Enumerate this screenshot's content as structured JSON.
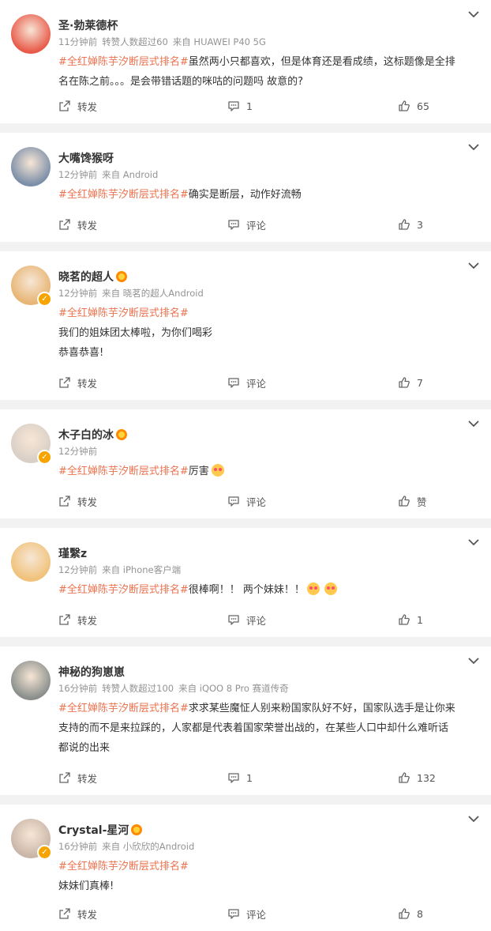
{
  "posts": [
    {
      "username": "圣·勃莱德杯",
      "has_badge": false,
      "verified": false,
      "meta": [
        "11分钟前",
        "转赞人数超过60",
        "来自 HUAWEI P40 5G"
      ],
      "lines": [
        [
          "#全红婵陈芋汐断层式排名#",
          "虽然两小只都喜欢，但是体育还是看成绩，这标题像是全排"
        ],
        [
          "",
          "名在陈之前。。。是会带错话题的咪咕的问题吗 故意的?"
        ]
      ],
      "forward_label": "转发",
      "comment_label": "1",
      "like_label": "65",
      "height": 156,
      "avatar_color": "#e85b4a"
    },
    {
      "username": "大嘴馋猴呀",
      "has_badge": false,
      "verified": false,
      "meta": [
        "12分钟前",
        "来自 Android"
      ],
      "lines": [
        [
          "#全红婵陈芋汐断层式排名#",
          "确实是断层，动作好流畅"
        ]
      ],
      "forward_label": "转发",
      "comment_label": "评论",
      "like_label": "3",
      "height": 138,
      "avatar_color": "#7c8fa8"
    },
    {
      "username": "晓茗的超人",
      "has_badge": true,
      "verified": true,
      "meta": [
        "12分钟前",
        "来自 晓茗的超人Android"
      ],
      "lines": [
        [
          "#全红婵陈芋汐断层式排名#",
          ""
        ],
        [
          "",
          "我们的姐妹团太棒啦，为你们喝彩"
        ],
        [
          "",
          "恭喜恭喜!"
        ]
      ],
      "forward_label": "转发",
      "comment_label": "评论",
      "like_label": "7",
      "height": 188,
      "avatar_color": "#e7b574"
    },
    {
      "username": "木子白的冰",
      "has_badge": true,
      "verified": true,
      "meta": [
        "12分钟前"
      ],
      "lines": [
        [
          "#全红婵陈芋汐断层式排名#",
          "厉害",
          "emoji"
        ]
      ],
      "forward_label": "转发",
      "comment_label": "评论",
      "like_label": "赞",
      "height": 138,
      "avatar_color": "#d9cfc6"
    },
    {
      "username": "瑾繄z",
      "has_badge": false,
      "verified": false,
      "meta": [
        "12分钟前",
        "来自 iPhone客户端"
      ],
      "lines": [
        [
          "#全红婵陈芋汐断层式排名#",
          "很棒啊！！ 两个妹妹！！",
          "emoji2"
        ]
      ],
      "forward_label": "转发",
      "comment_label": "评论",
      "like_label": "1",
      "height": 138,
      "avatar_color": "#f0c27a"
    },
    {
      "username": "神秘的狗崽崽",
      "has_badge": false,
      "verified": false,
      "meta": [
        "16分钟前",
        "转赞人数超过100",
        "来自 iQOO 8 Pro 赛道传奇"
      ],
      "lines": [
        [
          "#全红婵陈芋汐断层式排名#",
          "求求某些魔怔人别来粉国家队好不好，国家队选手是让你来"
        ],
        [
          "",
          "支持的而不是来拉踩的，人家都是代表着国家荣誉出战的，在某些人口中却什么难听话"
        ],
        [
          "",
          "都说的出来"
        ]
      ],
      "forward_label": "转发",
      "comment_label": "1",
      "like_label": "132",
      "height": 188,
      "avatar_color": "#8a8f8c"
    },
    {
      "username": "Crystal-星河",
      "has_badge": true,
      "verified": true,
      "meta": [
        "16分钟前",
        "来自 小欣欣的Android"
      ],
      "lines": [
        [
          "#全红婵陈芋汐断层式排名#",
          ""
        ],
        [
          "",
          "妹妹们真棒!"
        ]
      ],
      "forward_label": "转发",
      "comment_label": "评论",
      "like_label": "8",
      "height": 160,
      "avatar_color": "#c9b6a8"
    }
  ]
}
